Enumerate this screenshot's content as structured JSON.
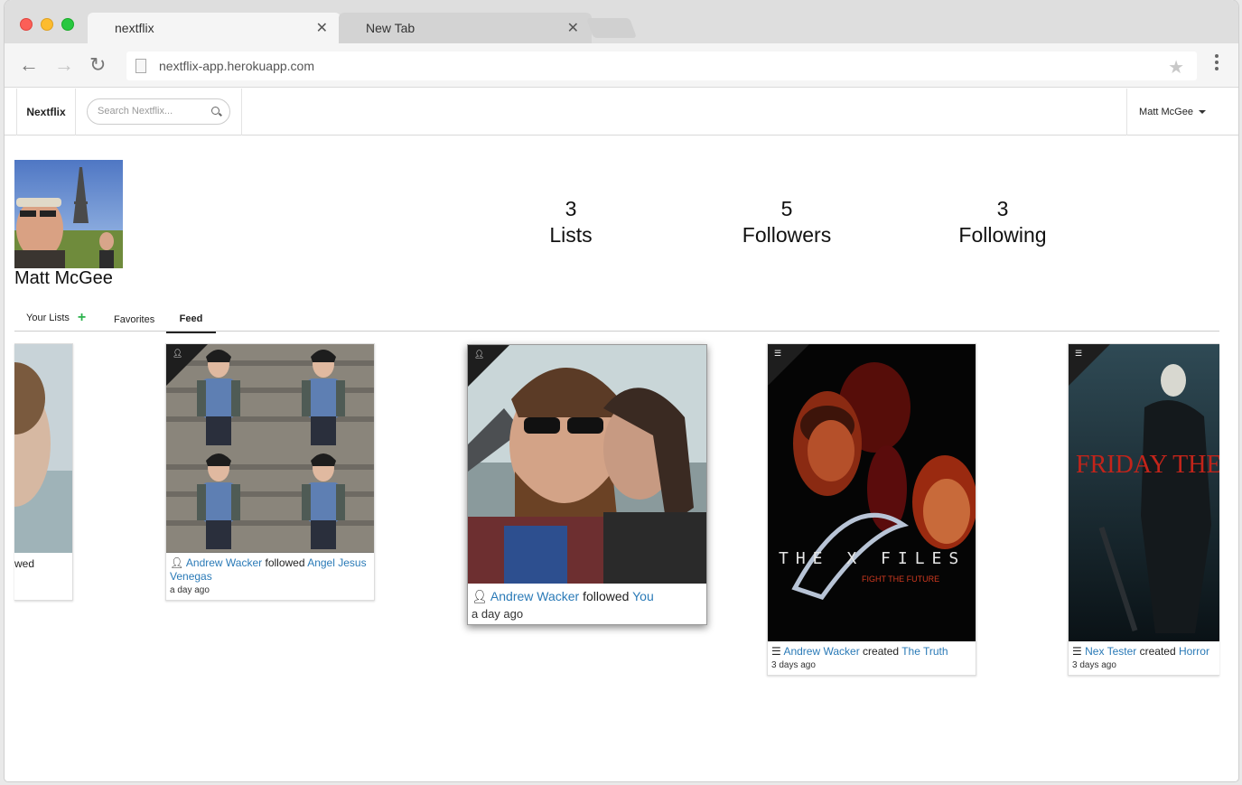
{
  "browser": {
    "tabs": [
      {
        "title": "nextflix",
        "active": true
      },
      {
        "title": "New Tab",
        "active": false
      }
    ],
    "url": "nextflix-app.herokuapp.com"
  },
  "navbar": {
    "brand": "Nextflix",
    "search_placeholder": "Search Nextflix...",
    "user": "Matt McGee"
  },
  "profile": {
    "name": "Matt McGee",
    "stats": [
      {
        "value": "3",
        "label": "Lists"
      },
      {
        "value": "5",
        "label": "Followers"
      },
      {
        "value": "3",
        "label": "Following"
      }
    ]
  },
  "profile_tabs": [
    "Your Lists",
    "Favorites",
    "Feed"
  ],
  "feed": [
    {
      "partial_text": "wed"
    },
    {
      "actor": "Andrew Wacker",
      "verb": "followed",
      "target": "Angel Jesus Venegas",
      "time": "a day ago",
      "icon": "user-icon"
    },
    {
      "actor": "Andrew Wacker",
      "verb": "followed",
      "target": "You",
      "time": "a day ago",
      "icon": "user-icon"
    },
    {
      "actor": "Andrew Wacker",
      "verb": "created",
      "target": "The Truth",
      "time": "3 days ago",
      "icon": "list-icon"
    },
    {
      "actor": "Nex Tester",
      "verb": "created",
      "target": "Horror",
      "time": "3 days ago",
      "icon": "list-icon"
    }
  ],
  "posters": {
    "xfiles_title": "THE X FILES",
    "xfiles_tagline": "FIGHT THE FUTURE",
    "friday_title": "FRIDAY THE"
  }
}
